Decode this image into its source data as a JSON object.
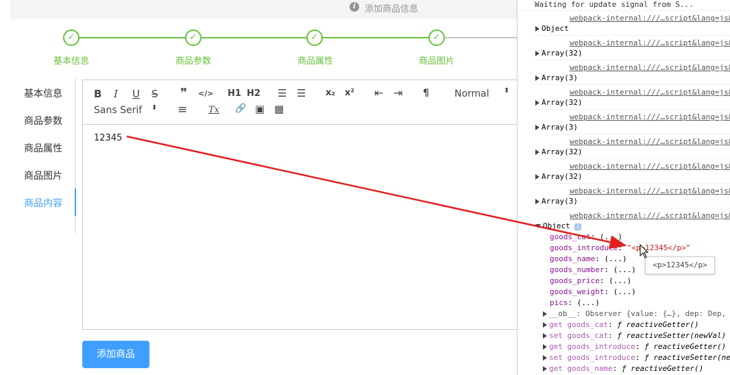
{
  "alert": {
    "icon": "info-circle-icon",
    "text": "添加商品信息"
  },
  "steps": [
    {
      "label": "基本信息",
      "icon": "check-icon"
    },
    {
      "label": "商品参数",
      "icon": "check-icon"
    },
    {
      "label": "商品属性",
      "icon": "check-icon"
    },
    {
      "label": "商品图片",
      "icon": "check-icon"
    }
  ],
  "tabs": [
    {
      "label": "基本信息",
      "active": false
    },
    {
      "label": "商品参数",
      "active": false
    },
    {
      "label": "商品属性",
      "active": false
    },
    {
      "label": "商品图片",
      "active": false
    },
    {
      "label": "商品内容",
      "active": true
    }
  ],
  "toolbar": {
    "bold": "B",
    "italic": "I",
    "underline": "U",
    "strike": "S",
    "quote": "❞",
    "code": "</>",
    "h1": "H1",
    "h2": "H2",
    "ordered_list": "☰",
    "bullet_list": "☰",
    "sub": "x₂",
    "sup": "x²",
    "outdent": "⇤",
    "indent": "⇥",
    "direction": "¶",
    "size_value": "Normal",
    "font_value": "Sans Serif",
    "align": "≡",
    "clean": "Tx",
    "link": "🔗",
    "image": "▣",
    "video": "▦"
  },
  "editor": {
    "content": "12345"
  },
  "add_button": "添加商品",
  "console": {
    "top_text": "Waiting for update signal from   S...",
    "link": "webpack-internal:///…script&lang=js&",
    "entries": [
      "Object",
      "Array(32)",
      "Array(3)",
      "Array(32)",
      "Array(3)",
      "Array(32)",
      "Array(32)",
      "Array(3)"
    ],
    "expanded_label": "Object",
    "props": [
      {
        "key": "goods_cat",
        "val": "(...)"
      },
      {
        "key": "goods_introduce",
        "val": "\"<p>12345</p>\""
      },
      {
        "key": "goods_name",
        "val": "(...)"
      },
      {
        "key": "goods_number",
        "val": "(...)"
      },
      {
        "key": "goods_price",
        "val": "(...)"
      },
      {
        "key": "goods_weight",
        "val": "(...)"
      },
      {
        "key": "pics",
        "val": "(...)"
      }
    ],
    "ob_line": "__ob__: Observer {value: {…}, dep: Dep,",
    "getters": [
      {
        "prefix": "get",
        "key": "goods_cat",
        "fn": "ƒ reactiveGetter()"
      },
      {
        "prefix": "set",
        "key": "goods_cat",
        "fn": "ƒ reactiveSetter(newVal)"
      },
      {
        "prefix": "get",
        "key": "goods_introduce",
        "fn": "ƒ reactiveGetter()"
      },
      {
        "prefix": "set",
        "key": "goods_introduce",
        "fn": "ƒ reactiveSetter(ne"
      },
      {
        "prefix": "get",
        "key": "goods_name",
        "fn": "ƒ reactiveGetter()"
      }
    ],
    "tooltip": "<p>12345</p>"
  }
}
